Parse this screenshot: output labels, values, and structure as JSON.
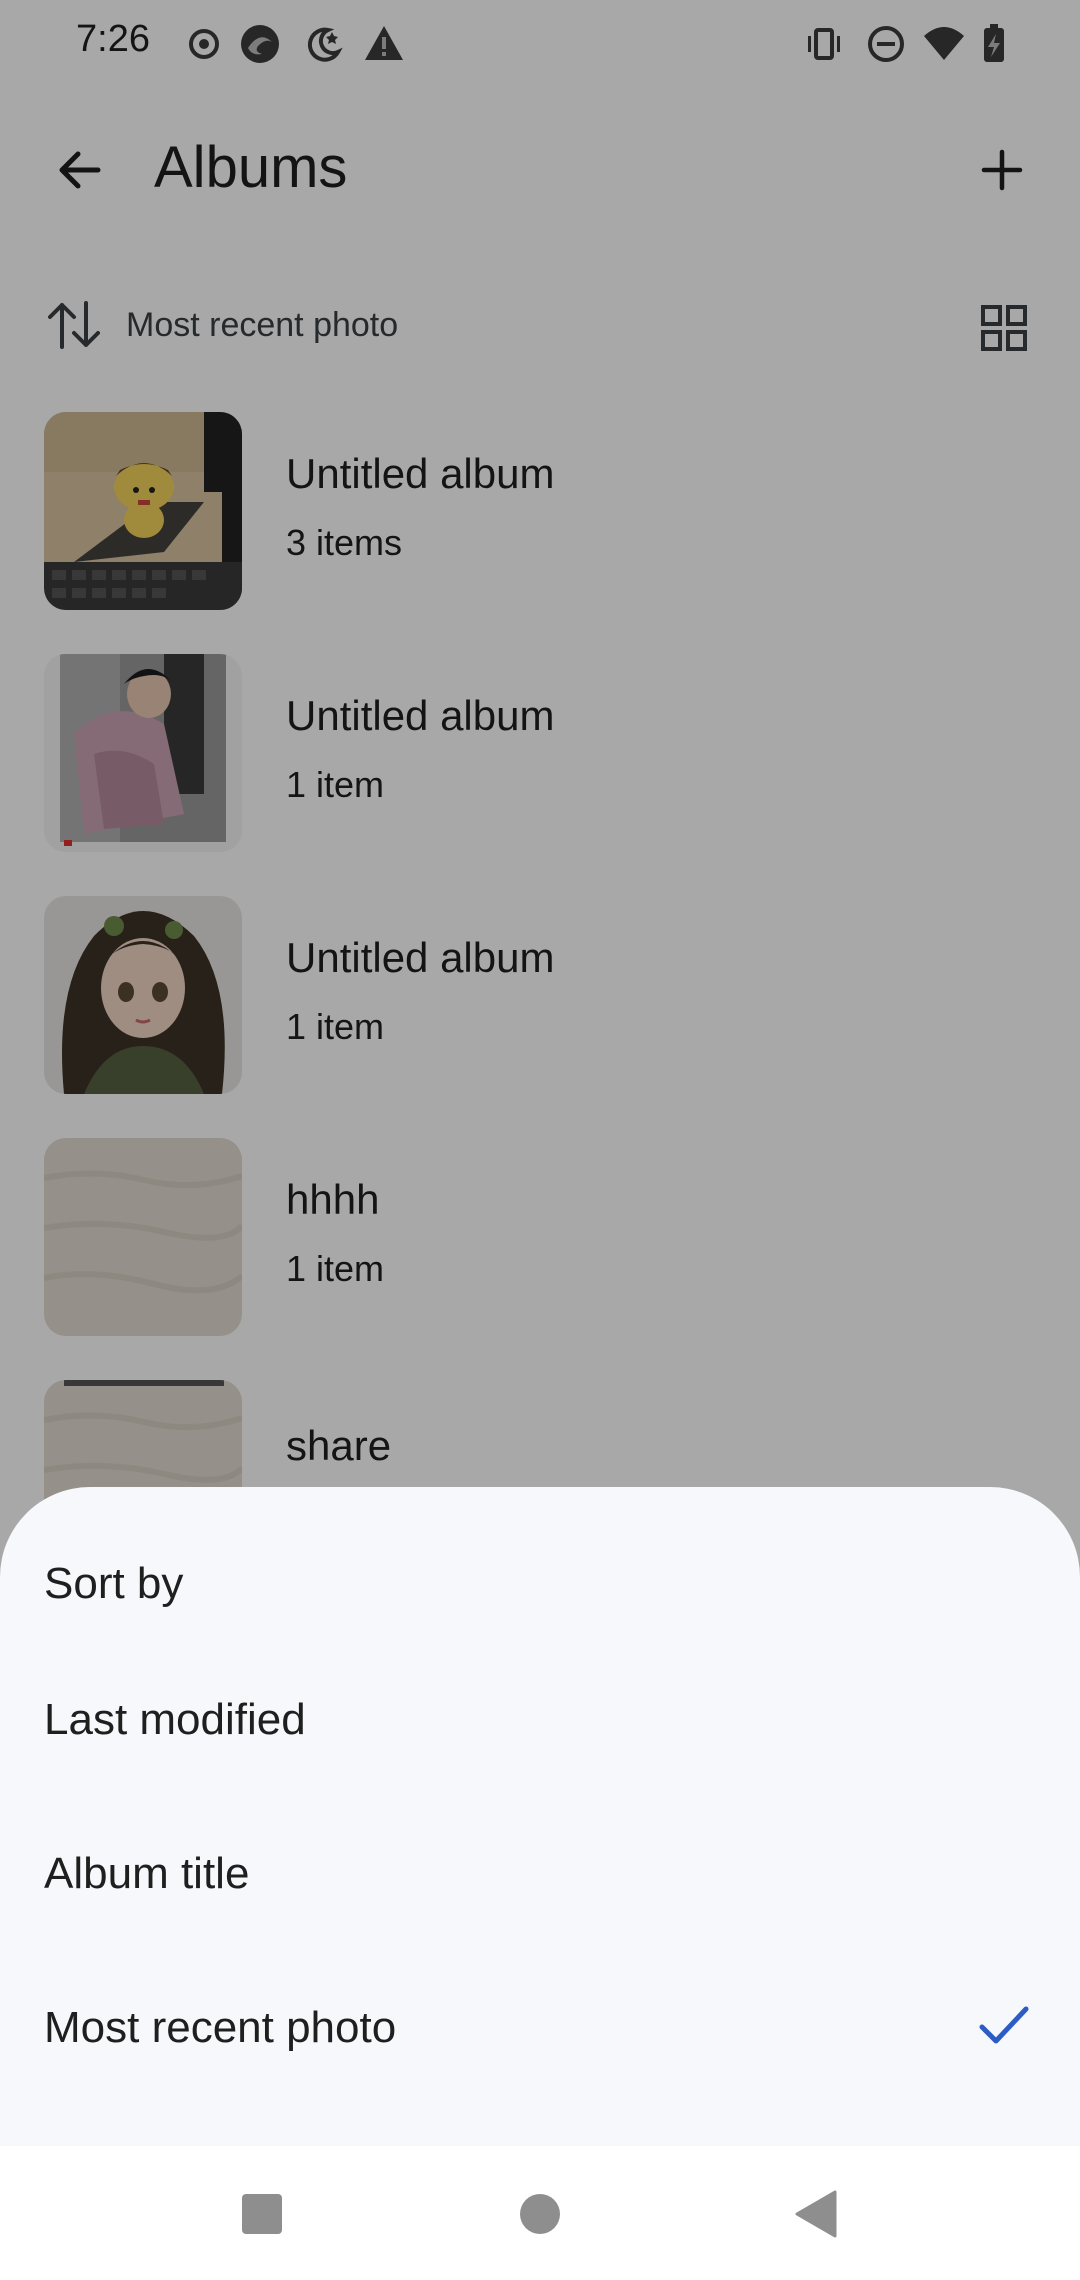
{
  "status_bar": {
    "time": "7:26"
  },
  "top_bar": {
    "title": "Albums"
  },
  "sort": {
    "current": "Most recent photo"
  },
  "albums": [
    {
      "title": "Untitled album",
      "count": "3 items",
      "thumb": "toy-on-desk"
    },
    {
      "title": "Untitled album",
      "count": "1 item",
      "thumb": "person-photo"
    },
    {
      "title": "Untitled album",
      "count": "1 item",
      "thumb": "anime-girl"
    },
    {
      "title": "hhhh",
      "count": "1 item",
      "thumb": "texture"
    },
    {
      "title": "share",
      "count": "",
      "thumb": "texture"
    }
  ],
  "sheet": {
    "title": "Sort by",
    "options": [
      {
        "label": "Last modified",
        "selected": false
      },
      {
        "label": "Album title",
        "selected": false
      },
      {
        "label": "Most recent photo",
        "selected": true
      }
    ]
  },
  "colors": {
    "accent": "#2c5cc5",
    "sheet_bg": "#f7f8fb",
    "scrim": "rgba(0,0,0,0.34)"
  }
}
